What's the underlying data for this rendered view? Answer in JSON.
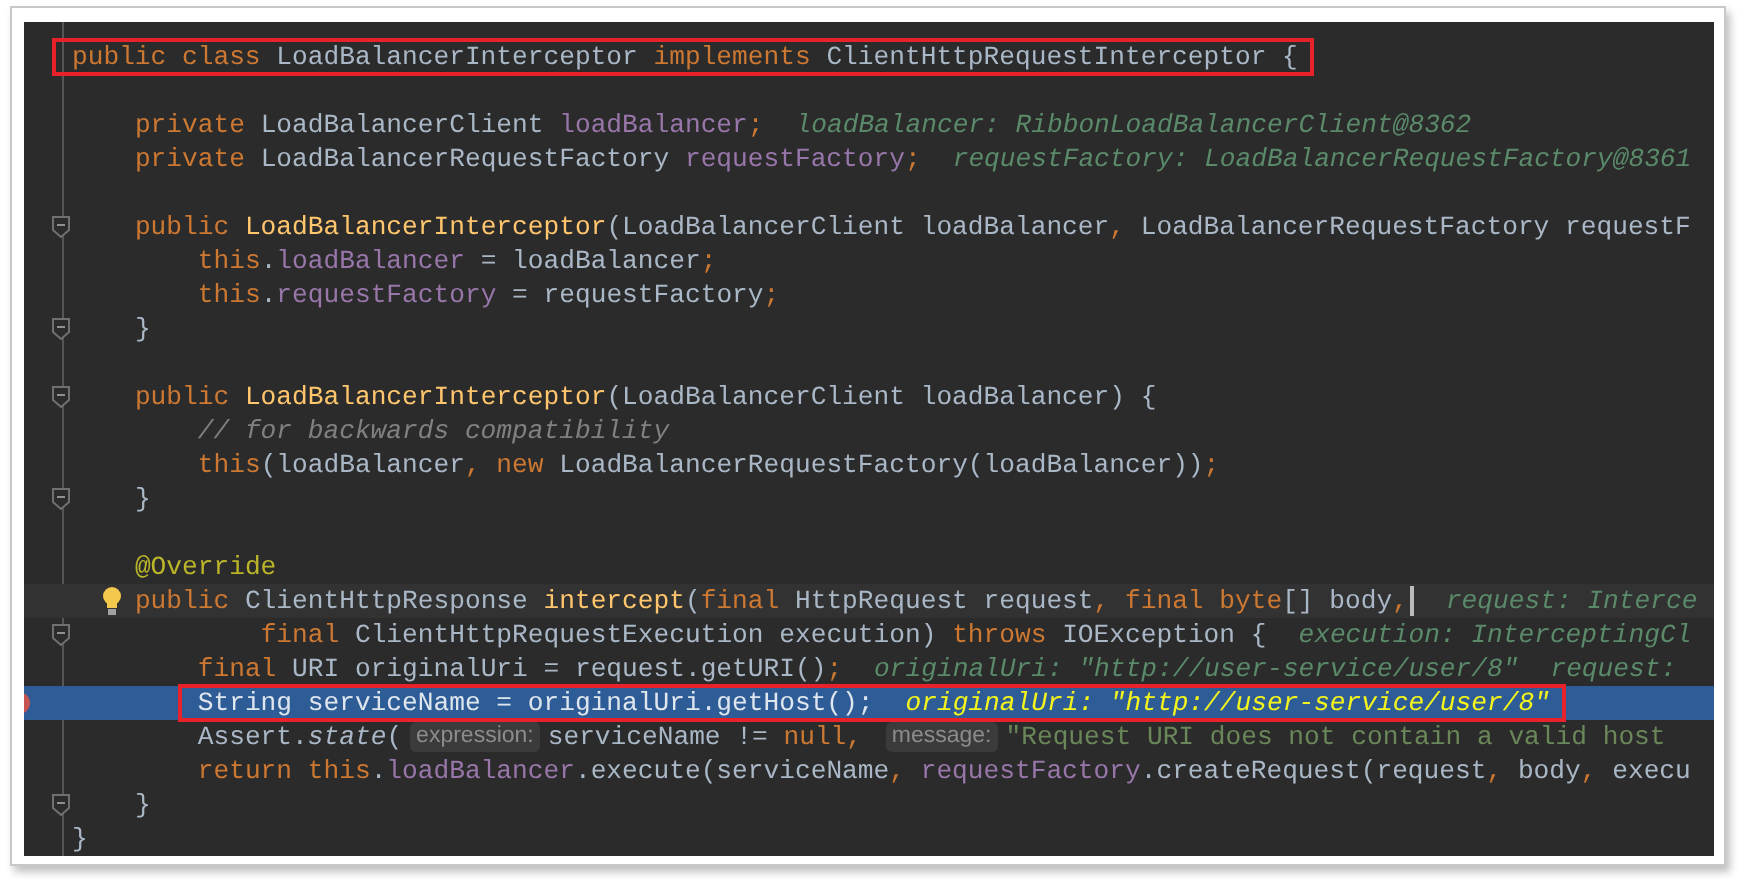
{
  "editor": {
    "lines": [
      {
        "kind": "code",
        "selected": false,
        "boxed": true,
        "tokens": [
          {
            "text": "public class ",
            "kind": "keyword"
          },
          {
            "text": "LoadBalancerInterceptor ",
            "kind": "plain"
          },
          {
            "text": "implements ",
            "kind": "keyword"
          },
          {
            "text": "ClientHttpRequestInterceptor {",
            "kind": "plain"
          }
        ]
      },
      {
        "kind": "blank",
        "selected": false
      },
      {
        "kind": "code",
        "selected": false,
        "tokens": [
          {
            "text": "    private ",
            "kind": "keyword"
          },
          {
            "text": "LoadBalancerClient ",
            "kind": "plain"
          },
          {
            "text": "loadBalancer",
            "kind": "field"
          },
          {
            "text": ";",
            "kind": "keyword"
          },
          {
            "text": "loadBalancer: RibbonLoadBalancerClient@8362",
            "kind": "hint"
          }
        ]
      },
      {
        "kind": "code",
        "selected": false,
        "tokens": [
          {
            "text": "    private ",
            "kind": "keyword"
          },
          {
            "text": "LoadBalancerRequestFactory ",
            "kind": "plain"
          },
          {
            "text": "requestFactory",
            "kind": "field"
          },
          {
            "text": ";",
            "kind": "keyword"
          },
          {
            "text": "requestFactory: LoadBalancerRequestFactory@8361",
            "kind": "hint"
          }
        ]
      },
      {
        "kind": "blank",
        "selected": false
      },
      {
        "kind": "code",
        "selected": false,
        "fold": true,
        "tokens": [
          {
            "text": "    public ",
            "kind": "keyword"
          },
          {
            "text": "LoadBalancerInterceptor",
            "kind": "method"
          },
          {
            "text": "(LoadBalancerClient loadBalancer",
            "kind": "plain"
          },
          {
            "text": ", ",
            "kind": "keyword"
          },
          {
            "text": "LoadBalancerRequestFactory requestF",
            "kind": "plain"
          }
        ]
      },
      {
        "kind": "code",
        "selected": false,
        "tokens": [
          {
            "text": "        this",
            "kind": "keyword"
          },
          {
            "text": ".",
            "kind": "plain"
          },
          {
            "text": "loadBalancer",
            "kind": "field"
          },
          {
            "text": " = loadBalancer",
            "kind": "plain"
          },
          {
            "text": ";",
            "kind": "keyword"
          }
        ]
      },
      {
        "kind": "code",
        "selected": false,
        "tokens": [
          {
            "text": "        this",
            "kind": "keyword"
          },
          {
            "text": ".",
            "kind": "plain"
          },
          {
            "text": "requestFactory",
            "kind": "field"
          },
          {
            "text": " = requestFactory",
            "kind": "plain"
          },
          {
            "text": ";",
            "kind": "keyword"
          }
        ]
      },
      {
        "kind": "code",
        "selected": false,
        "fold": true,
        "tokens": [
          {
            "text": "    }",
            "kind": "plain"
          }
        ]
      },
      {
        "kind": "blank",
        "selected": false
      },
      {
        "kind": "code",
        "selected": false,
        "fold": true,
        "tokens": [
          {
            "text": "    public ",
            "kind": "keyword"
          },
          {
            "text": "LoadBalancerInterceptor",
            "kind": "method"
          },
          {
            "text": "(LoadBalancerClient loadBalancer) {",
            "kind": "plain"
          }
        ]
      },
      {
        "kind": "code",
        "selected": false,
        "tokens": [
          {
            "text": "        // for backwards compatibility",
            "kind": "comment"
          }
        ]
      },
      {
        "kind": "code",
        "selected": false,
        "tokens": [
          {
            "text": "        this",
            "kind": "keyword"
          },
          {
            "text": "(loadBalancer",
            "kind": "plain"
          },
          {
            "text": ", new ",
            "kind": "keyword"
          },
          {
            "text": "LoadBalancerRequestFactory(loadBalancer))",
            "kind": "plain"
          },
          {
            "text": ";",
            "kind": "keyword"
          }
        ]
      },
      {
        "kind": "code",
        "selected": false,
        "fold": true,
        "tokens": [
          {
            "text": "    }",
            "kind": "plain"
          }
        ]
      },
      {
        "kind": "blank",
        "selected": false
      },
      {
        "kind": "code",
        "selected": false,
        "tokens": [
          {
            "text": "    @Override",
            "kind": "annotation"
          }
        ]
      },
      {
        "kind": "code",
        "selected": false,
        "current": true,
        "bulb": true,
        "caret": true,
        "tokens": [
          {
            "text": "    public ",
            "kind": "keyword"
          },
          {
            "text": "ClientHttpResponse ",
            "kind": "plain"
          },
          {
            "text": "intercept",
            "kind": "method"
          },
          {
            "text": "(",
            "kind": "plain"
          },
          {
            "text": "final ",
            "kind": "keyword"
          },
          {
            "text": "HttpRequest request",
            "kind": "plain"
          },
          {
            "text": ", final byte",
            "kind": "keyword"
          },
          {
            "text": "[] body",
            "kind": "plain"
          },
          {
            "text": ",",
            "kind": "keyword"
          },
          {
            "text": "request: Interce",
            "kind": "hint"
          }
        ]
      },
      {
        "kind": "code",
        "selected": false,
        "fold": true,
        "tokens": [
          {
            "text": "            final ",
            "kind": "keyword"
          },
          {
            "text": "ClientHttpRequestExecution execution) ",
            "kind": "plain"
          },
          {
            "text": "throws ",
            "kind": "keyword"
          },
          {
            "text": "IOException {",
            "kind": "plain"
          },
          {
            "text": "execution: InterceptingCl",
            "kind": "hint"
          }
        ]
      },
      {
        "kind": "code",
        "selected": false,
        "tokens": [
          {
            "text": "        final ",
            "kind": "keyword"
          },
          {
            "text": "URI originalUri = request.getURI()",
            "kind": "plain"
          },
          {
            "text": ";",
            "kind": "keyword"
          },
          {
            "text": "originalUri: \"http://user-service/user/8\"",
            "kind": "hint"
          },
          {
            "text": "request:",
            "kind": "hint"
          }
        ]
      },
      {
        "kind": "code",
        "selected": true,
        "boxed": true,
        "breakpoint": true,
        "tokens": [
          {
            "text": "        String serviceName = originalUri.getHost();",
            "kind": "plain"
          },
          {
            "text": "originalUri: \"http://user-service/user/8\"",
            "kind": "hint"
          }
        ]
      },
      {
        "kind": "code",
        "selected": false,
        "tokens": [
          {
            "text": "        Assert.",
            "kind": "plain"
          },
          {
            "text": "state",
            "kind": "static"
          },
          {
            "text": "(",
            "kind": "plain"
          },
          {
            "text": "expression:",
            "kind": "param_hint"
          },
          {
            "text": "serviceName != ",
            "kind": "plain"
          },
          {
            "text": "null, ",
            "kind": "keyword"
          },
          {
            "text": "message:",
            "kind": "param_hint"
          },
          {
            "text": "\"Request URI does not contain a valid host",
            "kind": "string"
          }
        ]
      },
      {
        "kind": "code",
        "selected": false,
        "tokens": [
          {
            "text": "        return this",
            "kind": "keyword"
          },
          {
            "text": ".",
            "kind": "plain"
          },
          {
            "text": "loadBalancer",
            "kind": "field"
          },
          {
            "text": ".execute(serviceName",
            "kind": "plain"
          },
          {
            "text": ", ",
            "kind": "keyword"
          },
          {
            "text": "requestFactory",
            "kind": "field"
          },
          {
            "text": ".createRequest(request",
            "kind": "plain"
          },
          {
            "text": ", ",
            "kind": "keyword"
          },
          {
            "text": "body",
            "kind": "plain"
          },
          {
            "text": ", ",
            "kind": "keyword"
          },
          {
            "text": "execu",
            "kind": "plain"
          }
        ]
      },
      {
        "kind": "code",
        "selected": false,
        "fold": true,
        "tokens": [
          {
            "text": "    }",
            "kind": "plain"
          }
        ]
      },
      {
        "kind": "code",
        "selected": false,
        "tokens": [
          {
            "text": "}",
            "kind": "plain"
          }
        ]
      }
    ]
  }
}
